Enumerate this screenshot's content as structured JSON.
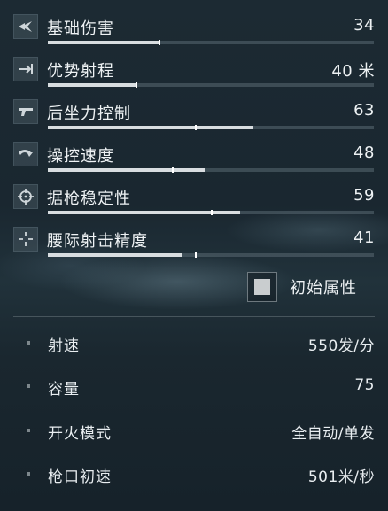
{
  "stats": [
    {
      "label": "基础伤害",
      "value": "34",
      "icon": "damage-icon",
      "fill": 0.34,
      "marker": 0.34
    },
    {
      "label": "优势射程",
      "value": "40 米",
      "icon": "range-icon",
      "fill": 0.27,
      "marker": 0.27
    },
    {
      "label": "后坐力控制",
      "value": "63",
      "icon": "recoil-icon",
      "fill": 0.63,
      "marker": 0.45
    },
    {
      "label": "操控速度",
      "value": "48",
      "icon": "handling-icon",
      "fill": 0.48,
      "marker": 0.38
    },
    {
      "label": "据枪稳定性",
      "value": "59",
      "icon": "stability-icon",
      "fill": 0.59,
      "marker": 0.5
    },
    {
      "label": "腰际射击精度",
      "value": "41",
      "icon": "hipfire-icon",
      "fill": 0.41,
      "marker": 0.45
    }
  ],
  "base_toggle": {
    "label": "初始属性",
    "checked": true
  },
  "specs": [
    {
      "label": "射速",
      "value": "550发/分"
    },
    {
      "label": "容量",
      "value": "75"
    },
    {
      "label": "开火模式",
      "value": "全自动/单发"
    },
    {
      "label": "枪口初速",
      "value": "501米/秒"
    }
  ]
}
